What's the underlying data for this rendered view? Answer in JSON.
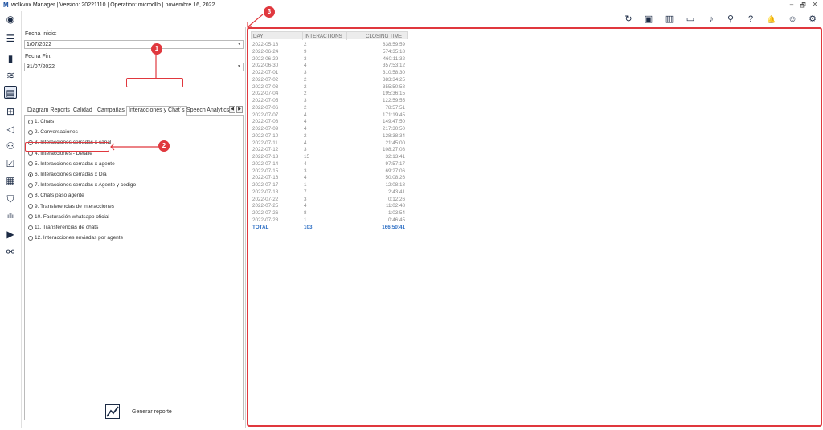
{
  "window": {
    "logo_letter": "M",
    "title": "wolkvox Manager  |  Version: 20221110  |  Operation: microdllo  |  noviembre 16, 2022",
    "controls": [
      "–",
      "🗗",
      "✕"
    ]
  },
  "sidebar": {
    "items": [
      {
        "name": "user-avatar-icon",
        "glyph": "◉"
      },
      {
        "name": "menu-icon",
        "glyph": "☰"
      },
      {
        "name": "bar-chart-icon",
        "glyph": "▮"
      },
      {
        "name": "analytics-icon",
        "glyph": "≋"
      },
      {
        "name": "reports-icon",
        "glyph": "▤",
        "active": true
      },
      {
        "name": "org-chart-icon",
        "glyph": "⊞"
      },
      {
        "name": "megaphone-icon",
        "glyph": "◁"
      },
      {
        "name": "users-icon",
        "glyph": "⚇"
      },
      {
        "name": "checklist-icon",
        "glyph": "☑"
      },
      {
        "name": "calculator-icon",
        "glyph": "▦"
      },
      {
        "name": "shield-icon",
        "glyph": "⛉"
      },
      {
        "name": "audio-wave-icon",
        "glyph": "ıllı"
      },
      {
        "name": "video-icon",
        "glyph": "▶"
      },
      {
        "name": "voicemail-icon",
        "glyph": "⚯"
      }
    ]
  },
  "toolbar": {
    "icons": [
      {
        "name": "refresh-icon",
        "glyph": "↻"
      },
      {
        "name": "briefcase-icon",
        "glyph": "▣"
      },
      {
        "name": "book-icon",
        "glyph": "▥"
      },
      {
        "name": "contact-card-icon",
        "glyph": "▭"
      },
      {
        "name": "music-note-icon",
        "glyph": "♪"
      },
      {
        "name": "microphone-icon",
        "glyph": "⚲"
      },
      {
        "name": "help-icon",
        "glyph": "?"
      },
      {
        "name": "bell-icon",
        "glyph": "🔔"
      },
      {
        "name": "account-icon",
        "glyph": "☺"
      },
      {
        "name": "settings-icon",
        "glyph": "⚙"
      }
    ]
  },
  "filters": {
    "start_label": "Fecha Inicio:",
    "start_value": "1/07/2022",
    "end_label": "Fecha Fin:",
    "end_value": "31/07/2022"
  },
  "tabs": [
    {
      "label": "Diagram Reports"
    },
    {
      "label": "Calidad"
    },
    {
      "label": "Campañas"
    },
    {
      "label": "Interacciones y Chat´s",
      "active": true
    },
    {
      "label": "Speech Analytics"
    }
  ],
  "tab_arrows": {
    "left": "◀",
    "right": "▶"
  },
  "reports": [
    {
      "label": "1. Chats"
    },
    {
      "label": "2. Conversaciones"
    },
    {
      "label": "3. Interacciones cerradas x canal"
    },
    {
      "label": "4. Interacciones - Detalle"
    },
    {
      "label": "5. Interacciones cerradas x agente"
    },
    {
      "label": "6. Interacciones cerradas x Dia",
      "selected": true
    },
    {
      "label": "7. Interacciones cerradas x Agente y codigo"
    },
    {
      "label": "8. Chats paso agente"
    },
    {
      "label": "9. Transferencias de interacciones"
    },
    {
      "label": "10. Facturación whatsapp oficial"
    },
    {
      "label": "11. Transferencias de chats"
    },
    {
      "label": "12. Interacciones enviadas por agente"
    }
  ],
  "generate_button": {
    "label": "Generar reporte"
  },
  "annotations": {
    "one": "1",
    "two": "2",
    "three": "3"
  },
  "annotation_color": "#e0383e",
  "table": {
    "headers": [
      "DAY",
      "INTERACTIONS",
      "CLOSING TIME"
    ],
    "rows": [
      [
        "2022-05-18",
        "2",
        "838:59:59"
      ],
      [
        "2022-06-24",
        "9",
        "574:35:18"
      ],
      [
        "2022-06-29",
        "3",
        "460:11:32"
      ],
      [
        "2022-06-30",
        "4",
        "357:53:12"
      ],
      [
        "2022-07-01",
        "3",
        "310:58:30"
      ],
      [
        "2022-07-02",
        "2",
        "383:34:25"
      ],
      [
        "2022-07-03",
        "2",
        "355:50:58"
      ],
      [
        "2022-07-04",
        "2",
        "195:36:15"
      ],
      [
        "2022-07-05",
        "3",
        "122:59:55"
      ],
      [
        "2022-07-06",
        "2",
        "78:57:51"
      ],
      [
        "2022-07-07",
        "4",
        "171:19:45"
      ],
      [
        "2022-07-08",
        "4",
        "149:47:50"
      ],
      [
        "2022-07-09",
        "4",
        "217:30:50"
      ],
      [
        "2022-07-10",
        "2",
        "128:38:34"
      ],
      [
        "2022-07-11",
        "4",
        "21:45:00"
      ],
      [
        "2022-07-12",
        "3",
        "108:27:08"
      ],
      [
        "2022-07-13",
        "15",
        "32:13:41"
      ],
      [
        "2022-07-14",
        "4",
        "97:57:17"
      ],
      [
        "2022-07-15",
        "3",
        "69:27:06"
      ],
      [
        "2022-07-16",
        "4",
        "50:08:26"
      ],
      [
        "2022-07-17",
        "1",
        "12:08:18"
      ],
      [
        "2022-07-18",
        "7",
        "2:43:41"
      ],
      [
        "2022-07-22",
        "3",
        "0:12:26"
      ],
      [
        "2022-07-25",
        "4",
        "11:02:48"
      ],
      [
        "2022-07-26",
        "8",
        "1:03:54"
      ],
      [
        "2022-07-28",
        "1",
        "0:46:45"
      ]
    ],
    "total": [
      "TOTAL",
      "103",
      "166:50:41"
    ]
  }
}
